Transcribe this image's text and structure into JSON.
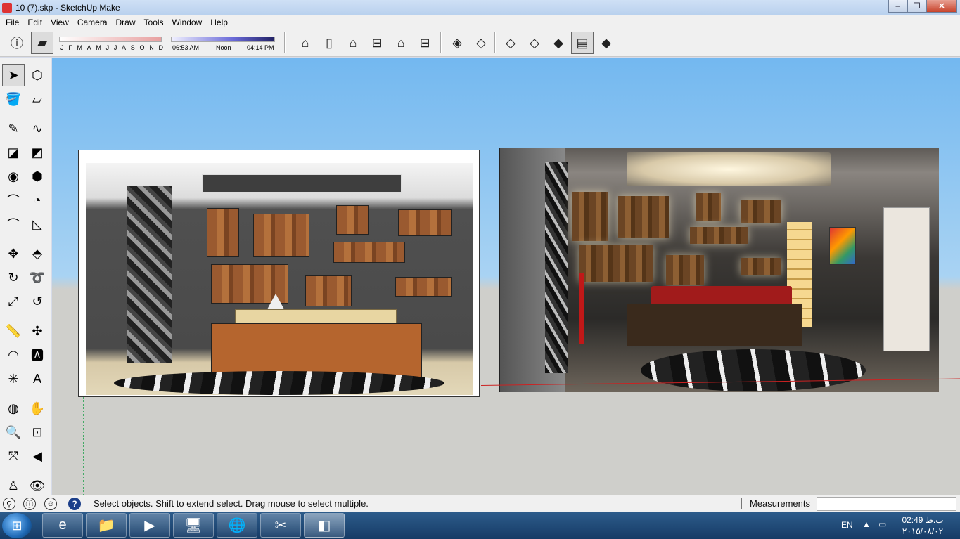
{
  "window": {
    "title": "10 (7).skp - SketchUp Make",
    "minimize": "–",
    "maximize": "❐",
    "close": "✕"
  },
  "menu": [
    "File",
    "Edit",
    "View",
    "Camera",
    "Draw",
    "Tools",
    "Window",
    "Help"
  ],
  "shadow": {
    "months": [
      "J",
      "F",
      "M",
      "A",
      "M",
      "J",
      "J",
      "A",
      "S",
      "O",
      "N",
      "D"
    ],
    "time_start": "06:53 AM",
    "time_mid": "Noon",
    "time_end": "04:14 PM"
  },
  "toolbar_icons": [
    "shadow-settings-icon",
    "display-shadows-icon",
    "iso-view-icon",
    "top-view-icon",
    "front-view-icon",
    "right-view-icon",
    "back-view-icon",
    "left-view-icon",
    "xray-icon",
    "back-edges-icon",
    "wireframe-icon",
    "hidden-line-icon",
    "shaded-icon",
    "shaded-textures-icon",
    "monochrome-icon"
  ],
  "left_tools": [
    "select-icon",
    "make-component-icon",
    "paint-bucket-icon",
    "eraser-icon",
    "line-icon",
    "freehand-icon",
    "rectangle-icon",
    "rotated-rectangle-icon",
    "circle-icon",
    "polygon-icon",
    "arc-icon",
    "pie-icon",
    "two-point-arc-icon",
    "three-point-arc-icon",
    "move-icon",
    "push-pull-icon",
    "rotate-icon",
    "follow-me-icon",
    "scale-icon",
    "offset-icon",
    "tape-measure-icon",
    "dimension-icon",
    "protractor-icon",
    "text-icon",
    "axes-icon",
    "3d-text-icon",
    "orbit-icon",
    "pan-icon",
    "zoom-icon",
    "zoom-window-icon",
    "zoom-extents-icon",
    "previous-view-icon",
    "position-camera-icon",
    "look-around-icon"
  ],
  "status": {
    "message": "Select objects. Shift to extend select. Drag mouse to select multiple.",
    "measurements_label": "Measurements",
    "measurements_value": "",
    "help_glyph": "?"
  },
  "taskbar": {
    "apps": [
      "internet-explorer-icon",
      "file-explorer-icon",
      "media-player-icon",
      "remote-desktop-icon",
      "google-earth-icon",
      "paint-tool-icon",
      "sketchup-icon"
    ],
    "language": "EN",
    "time": "02:49 ب.ظ",
    "date": "۲۰۱۵/۰۸/۰۲"
  }
}
